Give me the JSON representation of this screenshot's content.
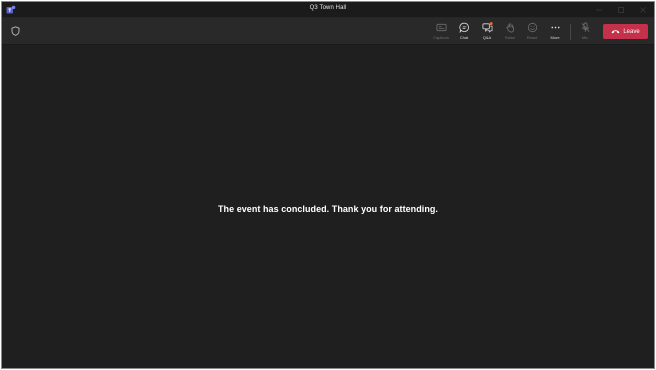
{
  "window": {
    "title": "Q3 Town Hall",
    "app_icon": "teams-logo-icon",
    "controls": [
      "minimize-icon",
      "maximize-icon",
      "close-icon"
    ]
  },
  "toolbar": {
    "shield_icon": "shield-icon",
    "buttons": [
      {
        "label": "Captions",
        "icon": "captions-icon",
        "enabled": false
      },
      {
        "label": "Chat",
        "icon": "chat-icon",
        "enabled": true
      },
      {
        "label": "Q&A",
        "icon": "qna-icon",
        "enabled": true,
        "badge": true
      },
      {
        "label": "Raise",
        "icon": "raise-hand-icon",
        "enabled": false
      },
      {
        "label": "React",
        "icon": "react-icon",
        "enabled": false
      },
      {
        "label": "More",
        "icon": "more-icon",
        "enabled": true
      },
      {
        "label": "Mic",
        "icon": "mic-icon",
        "enabled": false
      }
    ],
    "leave_label": "Leave"
  },
  "stage": {
    "message": "The event has concluded. Thank you for attending."
  },
  "colors": {
    "window_bg": "#1f1f1f",
    "toolbar_bg": "#292929",
    "leave_bg": "#c4314b",
    "badge": "#e8703a",
    "logo": "#6264a7"
  }
}
